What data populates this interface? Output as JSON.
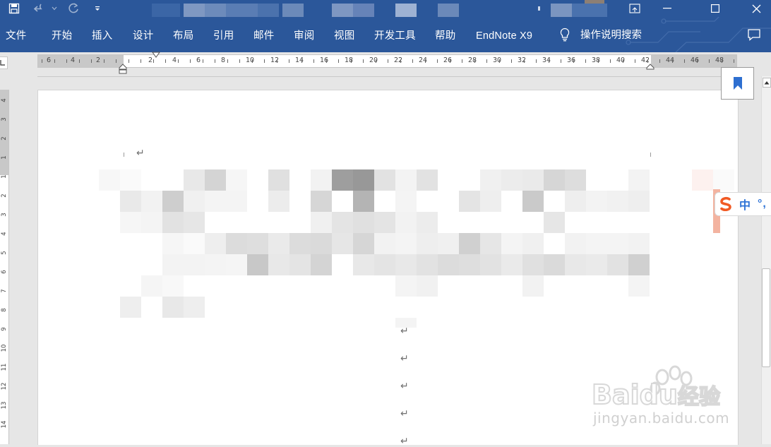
{
  "ribbon": {
    "tabs": [
      "文件",
      "开始",
      "插入",
      "设计",
      "布局",
      "引用",
      "邮件",
      "审阅",
      "视图",
      "开发工具",
      "帮助",
      "EndNote X9"
    ],
    "tell_me": "操作说明搜索"
  },
  "ruler": {
    "horizontal_labels": [
      "6",
      "4",
      "2",
      "2",
      "4",
      "6",
      "8",
      "10",
      "12",
      "14",
      "16",
      "18",
      "20",
      "22",
      "24",
      "26",
      "28",
      "30",
      "32",
      "34",
      "36",
      "38",
      "40",
      "42",
      "44",
      "46",
      "48"
    ],
    "vertical_labels": [
      "4",
      "3",
      "2",
      "1",
      "1",
      "2",
      "3",
      "4",
      "5",
      "6",
      "7",
      "8",
      "9",
      "10",
      "11",
      "12",
      "13",
      "14"
    ]
  },
  "document": {
    "paragraph_mark": "↵"
  },
  "ime": {
    "mode": "中",
    "punct": "°,"
  },
  "watermark": {
    "text": "jingyan.baidu.com"
  },
  "colors": {
    "ribbon": "#2b579a",
    "page": "#ffffff",
    "workspace": "#e6e6e6",
    "ime_accent": "#2e73d6"
  }
}
